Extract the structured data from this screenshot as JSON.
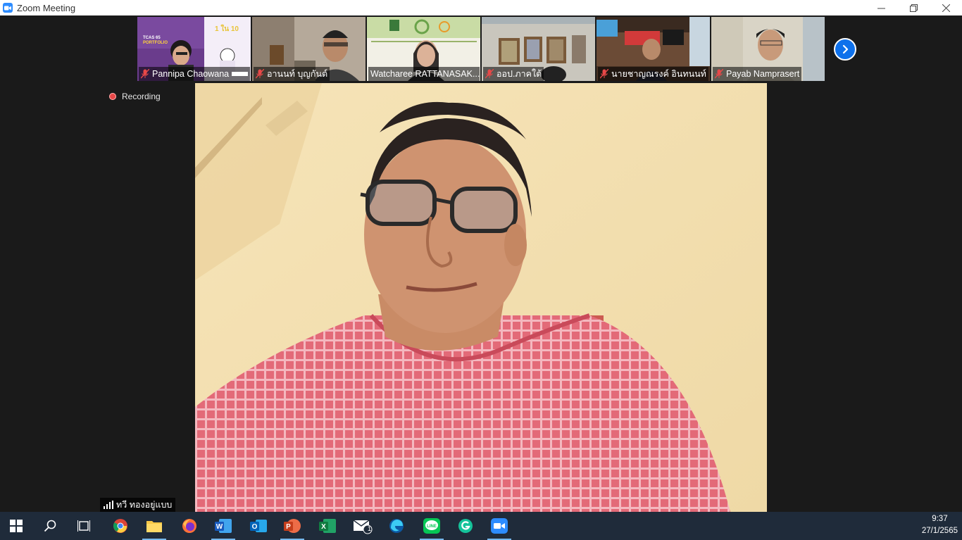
{
  "window": {
    "title": "Zoom Meeting",
    "minimize": "—",
    "restore": "❐",
    "close": "✕"
  },
  "participants": [
    {
      "name": "Pannipa Chaowana",
      "muted": false
    },
    {
      "name": "อานนท์  บุญกันต์",
      "muted": true
    },
    {
      "name": "Watcharee RATTANASAK...",
      "muted": false
    },
    {
      "name": "ออป.ภาคใต้",
      "muted": true
    },
    {
      "name": "นายชาญณรงค์  อินทนนท์",
      "muted": true
    },
    {
      "name": "Payab Namprasert",
      "muted": true
    }
  ],
  "thumb_texts": {
    "pannipa_banner_big": "1 ใน 10",
    "pannipa_banner_tcas": "TCAS 65",
    "pannipa_banner_portfolio": "PORTFOLIO"
  },
  "recording": {
    "label": "Recording"
  },
  "active_speaker": {
    "name": "ทวี  ทองอยู่แบบ"
  },
  "taskbar": {
    "apps": [
      "start",
      "search",
      "task-view",
      "chrome",
      "file-explorer",
      "firefox",
      "word",
      "outlook",
      "powerpoint",
      "excel",
      "mail",
      "edge",
      "line",
      "grammarly",
      "zoom"
    ],
    "mail_badge": "1",
    "time": "9:37",
    "date": "27/1/2565"
  },
  "colors": {
    "zoom_blue": "#0e71eb",
    "taskbar": "#1f2b3a",
    "recording_red": "#e84848"
  }
}
